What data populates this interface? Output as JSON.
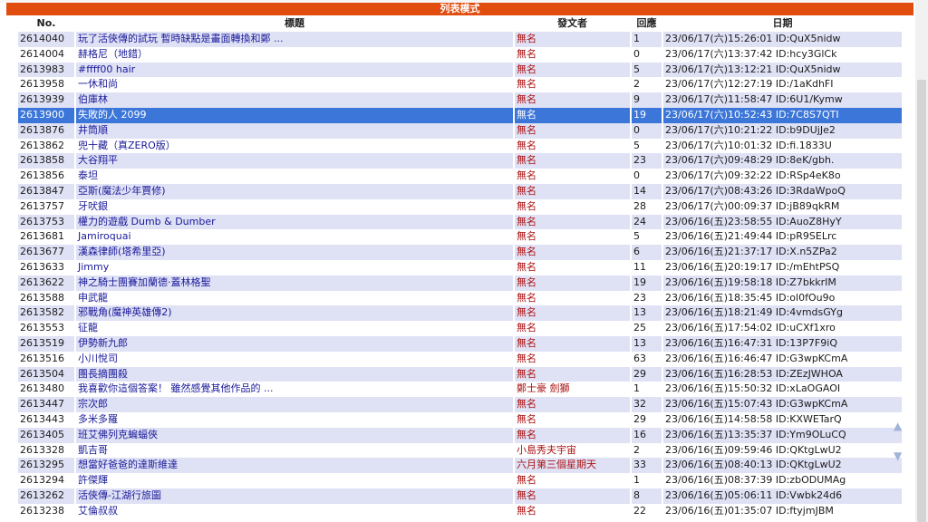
{
  "title_bar": "列表模式",
  "columns": {
    "no": "No.",
    "title": "標題",
    "author": "發文者",
    "replies": "回應",
    "date": "日期"
  },
  "selected_row": 5,
  "icons": {
    "scroll_up": "up-arrow-icon",
    "scroll_down": "down-arrow-icon"
  },
  "rows": [
    {
      "no": "2614040",
      "title": "玩了活俠傳的試玩 暫時缺點是畫面轉換和鄭 ...",
      "author": "無名",
      "replies": "1",
      "date": "23/06/17(六)15:26:01 ID:QuX5nidw"
    },
    {
      "no": "2614004",
      "title": "赫格尼（地錯）",
      "author": "無名",
      "replies": "0",
      "date": "23/06/17(六)13:37:42 ID:hcy3GlCk"
    },
    {
      "no": "2613983",
      "title": "#ffff00 hair",
      "author": "無名",
      "replies": "5",
      "date": "23/06/17(六)13:12:21 ID:QuX5nidw"
    },
    {
      "no": "2613958",
      "title": "一休和尚",
      "author": "無名",
      "replies": "2",
      "date": "23/06/17(六)12:27:19 ID:/1aKdhFI"
    },
    {
      "no": "2613939",
      "title": "伯庫林",
      "author": "無名",
      "replies": "9",
      "date": "23/06/17(六)11:58:47 ID:6U1/Kymw"
    },
    {
      "no": "2613900",
      "title": "失敗的人 2099",
      "author": "無名",
      "replies": "19",
      "date": "23/06/17(六)10:52:43 ID:7C8S7QTI"
    },
    {
      "no": "2613876",
      "title": "井筒順",
      "author": "無名",
      "replies": "0",
      "date": "23/06/17(六)10:21:22 ID:b9DUjJe2"
    },
    {
      "no": "2613862",
      "title": "兜十藏（真ZERO版）",
      "author": "無名",
      "replies": "5",
      "date": "23/06/17(六)10:01:32 ID:fi.1833U"
    },
    {
      "no": "2613858",
      "title": "大谷翔平",
      "author": "無名",
      "replies": "23",
      "date": "23/06/17(六)09:48:29 ID:8eK/gbh."
    },
    {
      "no": "2613856",
      "title": "泰坦",
      "author": "無名",
      "replies": "0",
      "date": "23/06/17(六)09:32:22 ID:RSp4eK8o"
    },
    {
      "no": "2613847",
      "title": "亞斯(魔法少年賈修)",
      "author": "無名",
      "replies": "14",
      "date": "23/06/17(六)08:43:26 ID:3RdaWpoQ"
    },
    {
      "no": "2613757",
      "title": "牙吠銀",
      "author": "無名",
      "replies": "28",
      "date": "23/06/17(六)00:09:37 ID:jB89qkRM"
    },
    {
      "no": "2613753",
      "title": "權力的遊戲 Dumb & Dumber",
      "author": "無名",
      "replies": "24",
      "date": "23/06/16(五)23:58:55 ID:AuoZ8HyY"
    },
    {
      "no": "2613681",
      "title": "Jamiroquai",
      "author": "無名",
      "replies": "5",
      "date": "23/06/16(五)21:49:44 ID:pR9SELrc"
    },
    {
      "no": "2613677",
      "title": "漢森律師(塔希里亞)",
      "author": "無名",
      "replies": "6",
      "date": "23/06/16(五)21:37:17 ID:X.n5ZPa2"
    },
    {
      "no": "2613633",
      "title": "Jimmy",
      "author": "無名",
      "replies": "11",
      "date": "23/06/16(五)20:19:17 ID:/mEhtPSQ"
    },
    {
      "no": "2613622",
      "title": "神之騎士團賽加蘭德·蓋林格聖",
      "author": "無名",
      "replies": "19",
      "date": "23/06/16(五)19:58:18 ID:Z7bkkrIM"
    },
    {
      "no": "2613588",
      "title": "申武龍",
      "author": "無名",
      "replies": "23",
      "date": "23/06/16(五)18:35:45 ID:ol0fOu9o"
    },
    {
      "no": "2613582",
      "title": "邪戰角(魔神英雄傳2)",
      "author": "無名",
      "replies": "13",
      "date": "23/06/16(五)18:21:49 ID:4vmdsGYg"
    },
    {
      "no": "2613553",
      "title": "征龍",
      "author": "無名",
      "replies": "25",
      "date": "23/06/16(五)17:54:02 ID:uCXf1xro"
    },
    {
      "no": "2613519",
      "title": "伊勢新九郎",
      "author": "無名",
      "replies": "13",
      "date": "23/06/16(五)16:47:31 ID:13P7F9iQ"
    },
    {
      "no": "2613516",
      "title": "小川悅司",
      "author": "無名",
      "replies": "63",
      "date": "23/06/16(五)16:46:47 ID:G3wpKCmA"
    },
    {
      "no": "2613504",
      "title": "團長摘團殺",
      "author": "無名",
      "replies": "29",
      "date": "23/06/16(五)16:28:53 ID:ZEzJWHOA"
    },
    {
      "no": "2613480",
      "title": "我喜歡你這個答案！ 雖然感覺其他作品的 ...",
      "author": "鄭士豪 劍獅",
      "replies": "1",
      "date": "23/06/16(五)15:50:32 ID:xLaOGAOI"
    },
    {
      "no": "2613447",
      "title": "宗次郎",
      "author": "無名",
      "replies": "32",
      "date": "23/06/16(五)15:07:43 ID:G3wpKCmA"
    },
    {
      "no": "2613443",
      "title": "多米多羅",
      "author": "無名",
      "replies": "29",
      "date": "23/06/16(五)14:58:58 ID:KXWETarQ"
    },
    {
      "no": "2613405",
      "title": "班艾佛列克蝙蝠俠",
      "author": "無名",
      "replies": "16",
      "date": "23/06/16(五)13:35:37 ID:Ym9OLuCQ"
    },
    {
      "no": "2613328",
      "title": "凱吉哥",
      "author": "小島秀夫宇宙",
      "replies": "2",
      "date": "23/06/16(五)09:59:46 ID:QKtgLwU2"
    },
    {
      "no": "2613295",
      "title": "想當好爸爸的達斯維達",
      "author": "六月第三個星期天",
      "replies": "33",
      "date": "23/06/16(五)08:40:13 ID:QKtgLwU2"
    },
    {
      "no": "2613294",
      "title": "許傑輝",
      "author": "無名",
      "replies": "1",
      "date": "23/06/16(五)08:37:39 ID:zbODUMAg"
    },
    {
      "no": "2613262",
      "title": "活俠傳-江湖行旅圖",
      "author": "無名",
      "replies": "8",
      "date": "23/06/16(五)05:06:11 ID:Vwbk24d6"
    },
    {
      "no": "2613238",
      "title": "艾倫叔叔",
      "author": "無名",
      "replies": "22",
      "date": "23/06/16(五)01:35:07 ID:ftyjmJBM"
    }
  ]
}
